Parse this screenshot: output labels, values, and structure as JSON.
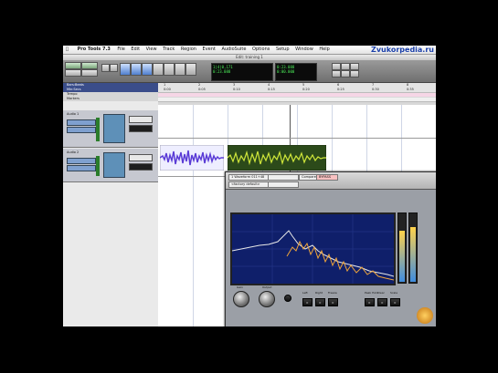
{
  "menubar": {
    "apple": "",
    "app": "Pro Tools 7.3",
    "items": [
      "File",
      "Edit",
      "View",
      "Track",
      "Region",
      "Event",
      "AudioSuite",
      "Options",
      "Setup",
      "Window",
      "Help"
    ],
    "watermark": "Zvukorpedia.ru"
  },
  "titlebar": {
    "title": "Edit: training 1"
  },
  "transport": {
    "counters": {
      "main": "1|4|0,171",
      "start": "0:23.088",
      "end": "0:23.088",
      "length": "0:00.000"
    }
  },
  "rulers": {
    "bars": [
      "1",
      "2",
      "3",
      "4",
      "5",
      "6",
      "7",
      "8"
    ],
    "mins": [
      "0:00",
      "0:05",
      "0:10",
      "0:15",
      "0:20",
      "0:25",
      "0:30",
      "0:35"
    ]
  },
  "tracks": {
    "ruler_labels": [
      "Bars:Beats",
      "Min:Secs",
      "Tempo",
      "Markers"
    ],
    "audio": [
      "Audio 1",
      "Audio 2"
    ]
  },
  "plugin": {
    "preset": "1 Waveform 011+48",
    "compare": "Compare",
    "bypass": "BYPASS",
    "setting": "<factory default>",
    "knob_labels": [
      "Gain",
      "Output"
    ],
    "buttons": [
      "Left",
      "Right",
      "Freeze",
      "Peak Hold",
      "Clear",
      "Scale"
    ]
  },
  "colors": {
    "waveform_purple": "#5a3bd6",
    "waveform_green": "#cfe63a",
    "analyzer_bg": "#0f1f6a"
  }
}
